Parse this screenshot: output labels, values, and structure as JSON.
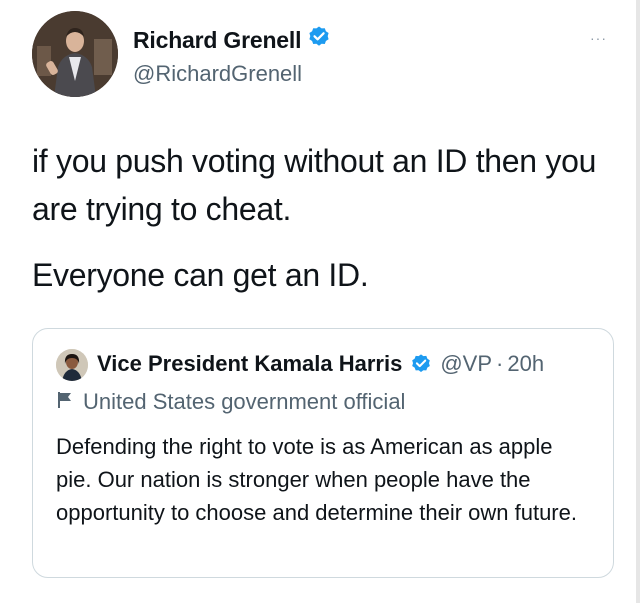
{
  "tweet": {
    "author": {
      "name": "Richard Grenell",
      "handle": "@RichardGrenell",
      "verified_icon": "verified-badge-icon"
    },
    "more_label": "···",
    "text_lines": [
      "if you push voting without an ID then you are trying to cheat.",
      "Everyone can get an ID."
    ]
  },
  "quote": {
    "name": "Vice President Kamala Harris",
    "handle": "@VP",
    "separator": "·",
    "time": "20h",
    "label": "United States government official",
    "label_icon": "flag-icon",
    "text": "Defending the right to vote is as American as apple pie. Our nation is stronger when people have the opportunity to choose and determine their own future."
  },
  "colors": {
    "verified_blue": "#1d9bf0",
    "text_primary": "#0f1419",
    "text_secondary": "#536471",
    "border": "#cfd9de"
  }
}
